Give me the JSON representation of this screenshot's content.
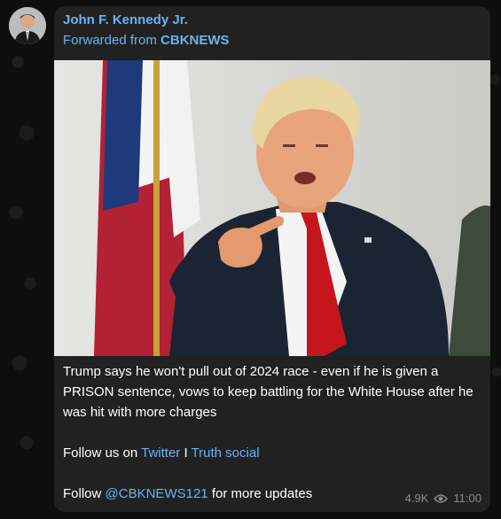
{
  "post": {
    "sender_name": "John F. Kennedy Jr.",
    "forwarded_prefix": "Forwarded from",
    "forwarded_source": "CBKNEWS",
    "caption": "Trump says he won't pull out of 2024 race - even if he is given a PRISON sentence, vows to keep battling for the White House after he was hit with more charges",
    "follow_prefix": "Follow us on",
    "twitter_link": "Twitter",
    "separator": "I",
    "truth_link": "Truth social",
    "follow2_prefix": "Follow",
    "channel_link": "@CBKNEWS121",
    "follow2_suffix": "for more updates",
    "views": "4.9K",
    "time": "11:00"
  },
  "icons": {
    "views": "eye-icon"
  },
  "colors": {
    "background": "#0e0e0e",
    "bubble": "#212121",
    "accent": "#6ab3f3",
    "text": "#ffffff",
    "meta": "#8a8a8a"
  }
}
